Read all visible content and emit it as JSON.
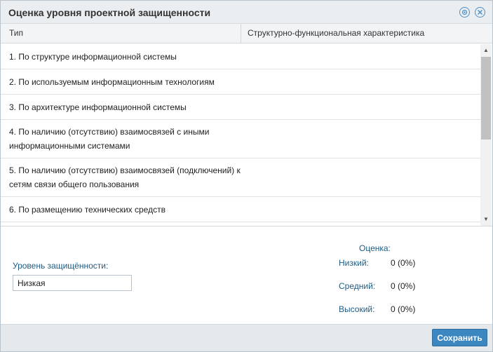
{
  "window": {
    "title": "Оценка уровня проектной защищенности",
    "help_icon": "help-icon",
    "close_icon": "close-icon"
  },
  "grid": {
    "columns": [
      "Тип",
      "Структурно-функциональная характеристика"
    ],
    "rows": [
      {
        "type": "1. По структуре информационной системы",
        "value": ""
      },
      {
        "type": "2. По используемым информационным технологиям",
        "value": ""
      },
      {
        "type": "3. По архитектуре информационной системы",
        "value": ""
      },
      {
        "type": "4. По наличию (отсутствию) взаимосвязей с иными информационными системами",
        "value": ""
      },
      {
        "type": "5. По наличию (отсутствию) взаимосвязей (подключений) к сетям связи общего пользования",
        "value": ""
      },
      {
        "type": "6. По размещению технических средств",
        "value": ""
      }
    ]
  },
  "level": {
    "label": "Уровень защищённости:",
    "value": "Низкая"
  },
  "score": {
    "title": "Оценка:",
    "items": [
      {
        "label": "Низкий:",
        "value": "0 (0%)"
      },
      {
        "label": "Средний:",
        "value": "0 (0%)"
      },
      {
        "label": "Высокий:",
        "value": "0 (0%)"
      }
    ]
  },
  "footer": {
    "save_label": "Сохранить"
  }
}
